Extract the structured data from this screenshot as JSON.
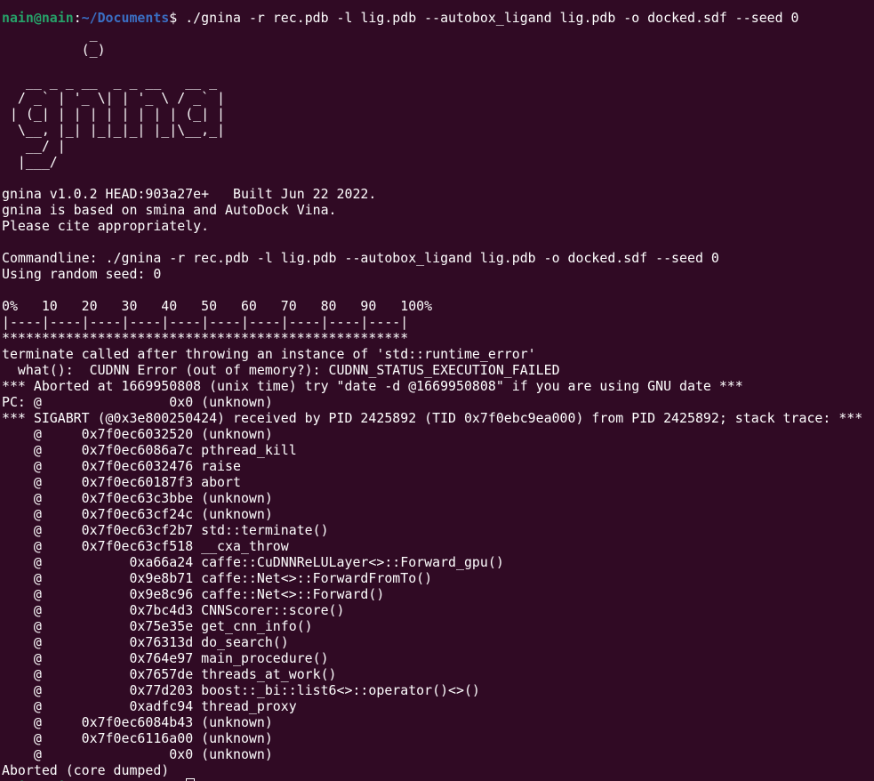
{
  "colors": {
    "background": "#300a24",
    "foreground": "#ffffff",
    "prompt_user": "#26a269",
    "prompt_path": "#3a6fc4"
  },
  "prompt": {
    "user_host": "nain@nain",
    "separator": ":",
    "path": "~/Documents",
    "symbol": "$ "
  },
  "command": "./gnina -r rec.pdb -l lig.pdb --autobox_ligand lig.pdb -o docked.sdf --seed 0",
  "banner": [
    "           _",
    "          (_)",
    "",
    "   __ _ _ __  _ _ __   __ _",
    "  / _` | '_ \\| | '_ \\ / _` |",
    " | (_| | | | | | | | | (_| |",
    "  \\__, |_| |_|_|_| |_|\\__,_|",
    "   __/ |",
    "  |___/"
  ],
  "output": [
    "",
    "gnina v1.0.2 HEAD:903a27e+   Built Jun 22 2022.",
    "gnina is based on smina and AutoDock Vina.",
    "Please cite appropriately.",
    "",
    "Commandline: ./gnina -r rec.pdb -l lig.pdb --autobox_ligand lig.pdb -o docked.sdf --seed 0",
    "Using random seed: 0",
    "",
    "0%   10   20   30   40   50   60   70   80   90   100%",
    "|----|----|----|----|----|----|----|----|----|----|",
    "***************************************************",
    "terminate called after throwing an instance of 'std::runtime_error'",
    "  what():  CUDNN Error (out of memory?): CUDNN_STATUS_EXECUTION_FAILED",
    "*** Aborted at 1669950808 (unix time) try \"date -d @1669950808\" if you are using GNU date ***",
    "PC: @                0x0 (unknown)",
    "*** SIGABRT (@0x3e800250424) received by PID 2425892 (TID 0x7f0ebc9ea000) from PID 2425892; stack trace: ***",
    "    @     0x7f0ec6032520 (unknown)",
    "    @     0x7f0ec6086a7c pthread_kill",
    "    @     0x7f0ec6032476 raise",
    "    @     0x7f0ec60187f3 abort",
    "    @     0x7f0ec63c3bbe (unknown)",
    "    @     0x7f0ec63cf24c (unknown)",
    "    @     0x7f0ec63cf2b7 std::terminate()",
    "    @     0x7f0ec63cf518 __cxa_throw",
    "    @           0xa66a24 caffe::CuDNNReLULayer<>::Forward_gpu()",
    "    @           0x9e8b71 caffe::Net<>::ForwardFromTo()",
    "    @           0x9e8c96 caffe::Net<>::Forward()",
    "    @           0x7bc4d3 CNNScorer::score()",
    "    @           0x75e35e get_cnn_info()",
    "    @           0x76313d do_search()",
    "    @           0x764e97 main_procedure()",
    "    @           0x7657de threads_at_work()",
    "    @           0x77d203 boost::_bi::list6<>::operator()<>()",
    "    @           0xadfc94 thread_proxy",
    "    @     0x7f0ec6084b43 (unknown)",
    "    @     0x7f0ec6116a00 (unknown)",
    "    @                0x0 (unknown)",
    "Aborted (core dumped)"
  ]
}
